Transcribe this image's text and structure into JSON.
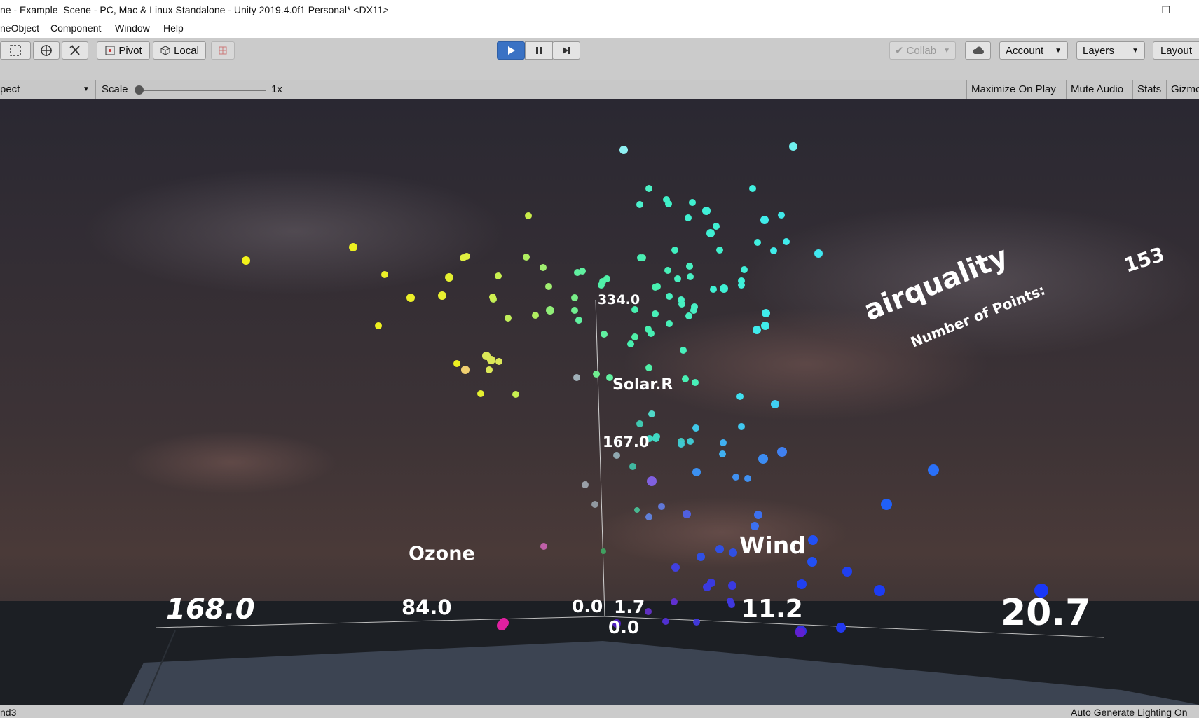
{
  "window": {
    "title": "ne - Example_Scene - PC, Mac & Linux Standalone - Unity 2019.4.0f1 Personal* <DX11>",
    "minimize_glyph": "—",
    "restore_glyph": "❐"
  },
  "menu": [
    "neObject",
    "Component",
    "Window",
    "Help"
  ],
  "toolbar": {
    "tool_icons": [
      "rect-tool-icon",
      "transform-tool-icon",
      "custom-tool-icon"
    ],
    "pivot_label": "Pivot",
    "local_label": "Local",
    "collab_label": "Collab",
    "account_label": "Account",
    "layers_label": "Layers",
    "layout_label": "Layout"
  },
  "game_view": {
    "aspect_label": "pect",
    "scale_label": "Scale",
    "scale_value": "1x",
    "scale_level": 0,
    "toggles": [
      "Maximize On Play",
      "Mute Audio",
      "Stats",
      "Gizmo"
    ]
  },
  "scene": {
    "dataset_title": "airquality",
    "points_label": "Number of Points:",
    "points_count": "153",
    "axes": {
      "y_name": "Solar.R",
      "x_name": "Ozone",
      "z_name": "Wind",
      "y_ticks": [
        "334.0",
        "167.0",
        "0.0"
      ],
      "x_ticks": [
        "168.0",
        "84.0",
        "0.0"
      ],
      "z_ticks": [
        "1.7",
        "11.2",
        "20.7"
      ]
    }
  },
  "status": {
    "left": "nd3",
    "right": "Auto Generate Lighting On"
  },
  "colors": {
    "accent_play": "#3a72c4",
    "sky_top": "#2a2832",
    "ground": "#303843"
  }
}
